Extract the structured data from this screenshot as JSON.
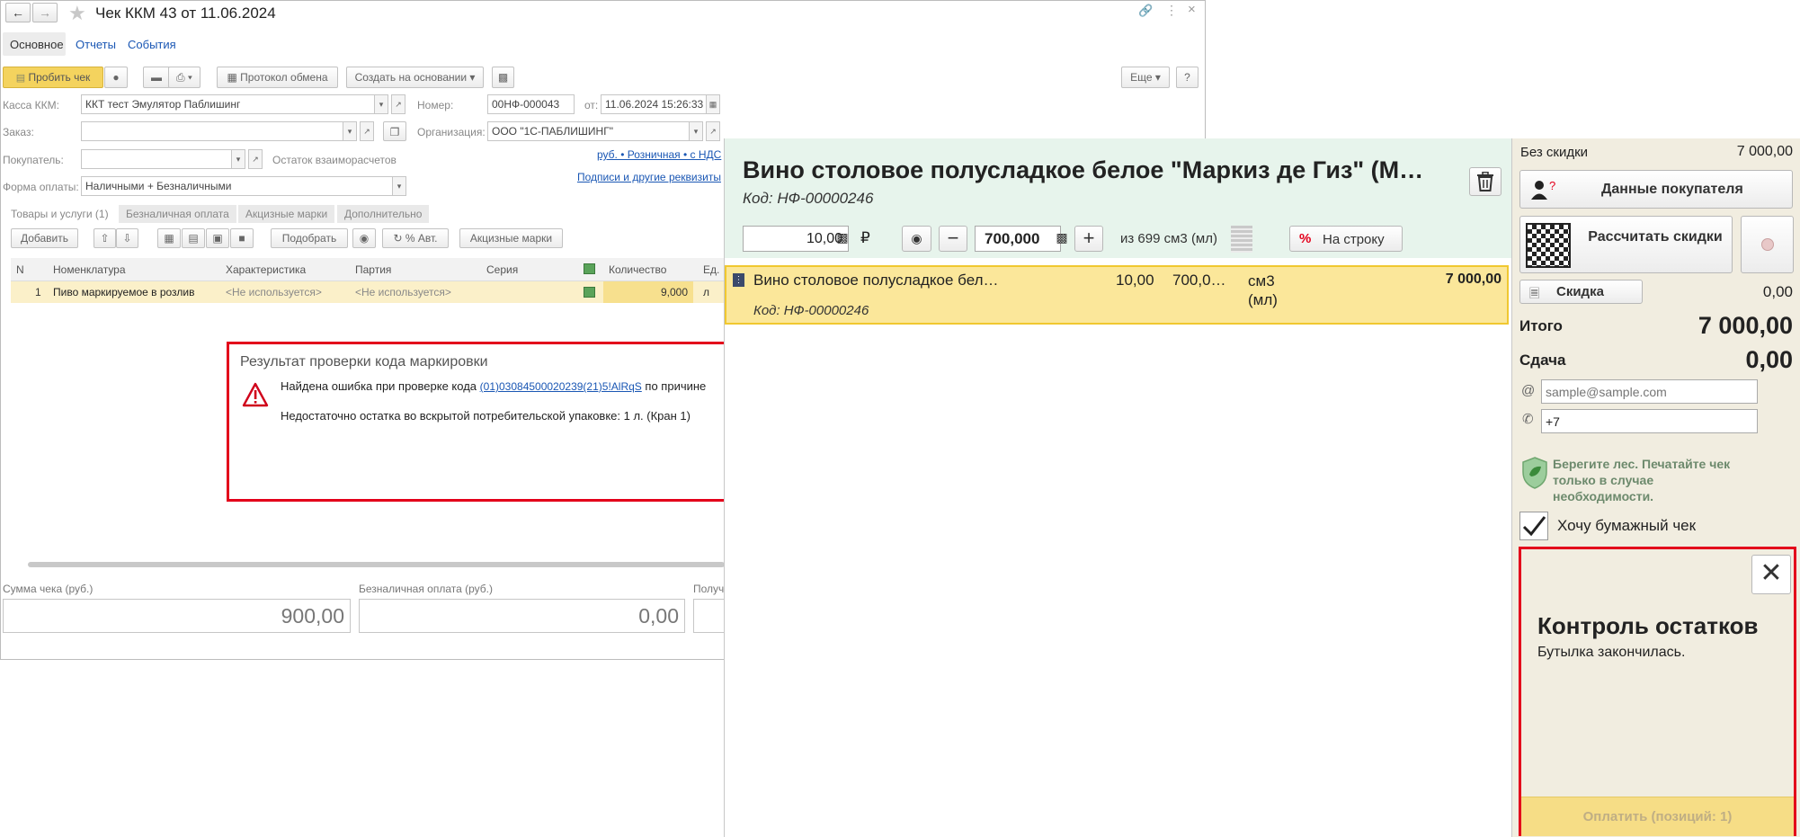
{
  "doc": {
    "title": "Чек ККМ 43 от 11.06.2024",
    "tabs": [
      "Основное",
      "Отчеты",
      "События"
    ],
    "toolbar": {
      "print_check": "Пробить чек",
      "exchange_protocol": "Протокол обмена",
      "create_based": "Создать на основании",
      "more": "Еще",
      "help": "?"
    },
    "form": {
      "kassa_label": "Касса ККМ:",
      "kassa_value": "ККТ тест Эмулятор Паблишинг",
      "number_label": "Номер:",
      "number_value": "00НФ-000043",
      "date_label": "от:",
      "date_value": "11.06.2024 15:26:33",
      "order_label": "Заказ:",
      "org_label": "Организация:",
      "org_value": "ООО \"1С-ПАБЛИШИНГ\"",
      "buyer_label": "Покупатель:",
      "balance_label": "Остаток взаиморасчетов",
      "price_link": "руб. • Розничная • с НДС",
      "signatures_link": "Подписи и другие реквизиты",
      "payment_label": "Форма оплаты:",
      "payment_value": "Наличными + Безналичными"
    },
    "subtabs": [
      "Товары и услуги (1)",
      "Безналичная оплата",
      "Акцизные марки",
      "Дополнительно"
    ],
    "tbl_toolbar": {
      "add": "Добавить",
      "pick": "Подобрать",
      "auto_pct": "% Авт.",
      "excise": "Акцизные марки"
    },
    "table": {
      "headers": [
        "N",
        "Номенклатура",
        "Характеристика",
        "Партия",
        "Серия",
        "Количество",
        "Ед."
      ],
      "rows": [
        {
          "n": "1",
          "name": "Пиво маркируемое в розлив",
          "char": "<Не используется>",
          "batch": "<Не используется>",
          "series": "",
          "qty": "9,000",
          "unit": "л"
        }
      ]
    },
    "totals": {
      "sum_label": "Сумма чека (руб.)",
      "sum_value": "900,00",
      "cashless_label": "Безналичная оплата (руб.)",
      "cashless_value": "0,00",
      "received_label": "Получ"
    },
    "error_box": {
      "title": "Результат проверки кода маркировки",
      "line1_prefix": "Найдена ошибка при проверке кода",
      "code_link": "(01)03084500020239(21)5!AlRqS",
      "line1_suffix": "по причине",
      "line2": "Недостаточно остатка во вскрытой потребительской упаковке: 1 л. (Кран 1)"
    }
  },
  "pos": {
    "product_title": "Вино столовое полусладкое белое \"Маркиз де Гиз\" (М…",
    "product_code": "Код: НФ-00000246",
    "price_value": "10,00",
    "currency": "₽",
    "qty_value": "700,000",
    "stock_text": "из 699 см3 (мл)",
    "to_line": "На строку",
    "line": {
      "name": "Вино столовое полусладкое бел…",
      "price": "10,00",
      "qty": "700,0…",
      "unit": "см3 (мл)",
      "sum": "7 000,00",
      "code": "Код: НФ-00000246"
    },
    "no_discount_label": "Без скидки",
    "no_discount_value": "7 000,00",
    "buyer_data": "Данные покупателя",
    "calc_discounts": "Рассчитать скидки",
    "discount_btn": "Скидка",
    "discount_value": "0,00",
    "total_label": "Итого",
    "total_value": "7 000,00",
    "change_label": "Сдача",
    "change_value": "0,00",
    "email_placeholder": "sample@sample.com",
    "phone_value": "+7",
    "eco_text": "Берегите лес. Печатайте чек только в случае необходимости.",
    "paper_check": "Хочу бумажный чек",
    "notice_title": "Контроль остатков",
    "notice_text": "Бутылка закончилась.",
    "pay_btn": "Оплатить (позиций: 1)"
  },
  "colors": {
    "accent_yellow": "#f5d35a",
    "error_red": "#e3001b",
    "pos_header_bg": "#e7f4ec",
    "right_panel_bg": "#f1ede0",
    "link_blue": "#1a57b4"
  }
}
